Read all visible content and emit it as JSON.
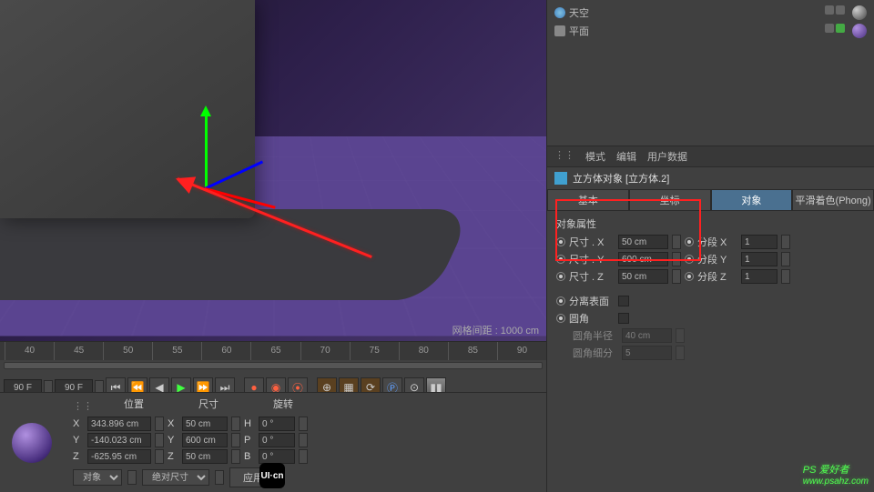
{
  "viewport": {
    "grid_info": "网格间距 : 1000 cm"
  },
  "timeline": {
    "ticks": [
      "40",
      "45",
      "50",
      "55",
      "60",
      "65",
      "70",
      "75",
      "80",
      "85",
      "90"
    ],
    "frame_start": "90 F",
    "frame_end": "90 F"
  },
  "coords": {
    "headers": {
      "pos": "位置",
      "size": "尺寸",
      "rot": "旋转"
    },
    "rows": [
      {
        "axis": "X",
        "pos": "343.896 cm",
        "size": "50 cm",
        "rot_label": "H",
        "rot": "0 °"
      },
      {
        "axis": "Y",
        "pos": "-140.023 cm",
        "size": "600 cm",
        "rot_label": "P",
        "rot": "0 °"
      },
      {
        "axis": "Z",
        "pos": "-625.95 cm",
        "size": "50 cm",
        "rot_label": "B",
        "rot": "0 °"
      }
    ],
    "footer": {
      "mode1": "对象",
      "mode2": "绝对尺寸",
      "apply": "应用"
    }
  },
  "objects": [
    {
      "name": "天空",
      "icon": "sky"
    },
    {
      "name": "平面",
      "icon": "plane"
    }
  ],
  "attr": {
    "menu": {
      "mode": "模式",
      "edit": "编辑",
      "userdata": "用户数据"
    },
    "title": "立方体对象 [立方体.2]",
    "tabs": {
      "basic": "基本",
      "coord": "坐标",
      "object": "对象",
      "phong": "平滑着色(Phong)"
    },
    "section": "对象属性",
    "props": {
      "sizeX": {
        "label": "尺寸 . X",
        "value": "50 cm",
        "seg_label": "分段 X",
        "seg_value": "1"
      },
      "sizeY": {
        "label": "尺寸 . Y",
        "value": "600 cm",
        "seg_label": "分段 Y",
        "seg_value": "1"
      },
      "sizeZ": {
        "label": "尺寸 . Z",
        "value": "50 cm",
        "seg_label": "分段 Z",
        "seg_value": "1"
      },
      "separate": "分离表面",
      "fillet": "圆角",
      "fillet_radius": {
        "label": "圆角半径",
        "value": "40 cm"
      },
      "fillet_sub": {
        "label": "圆角细分",
        "value": "5"
      }
    }
  },
  "watermark": {
    "title": "PS 爱好者",
    "url": "www.psahz.com"
  }
}
